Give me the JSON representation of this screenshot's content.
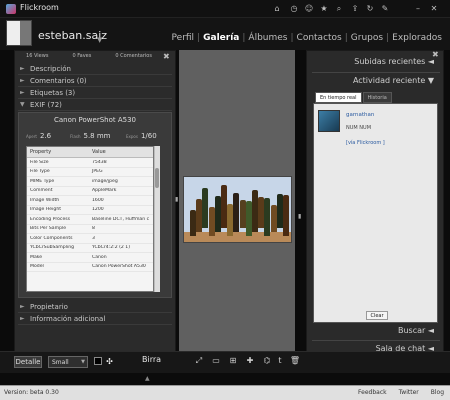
{
  "app": {
    "title": "Flickroom"
  },
  "titlebar_icons": [
    "home-icon",
    "clock-icon",
    "user-icon",
    "star-icon",
    "search-icon",
    "upload-icon",
    "refresh-icon",
    "tools-icon",
    "minimize-icon",
    "close-icon"
  ],
  "header": {
    "username": "esteban.saiz",
    "nav": [
      "Perfil",
      "Galería",
      "Álbumes",
      "Contactos",
      "Grupos",
      "Explorados"
    ],
    "active_nav": "Galería"
  },
  "left": {
    "counts": {
      "views": "16 Views",
      "faves": "0 Faves",
      "comments": "0 Comentarios"
    },
    "sections": [
      "Descripción",
      "Comentarios (0)",
      "Etiquetas (3)",
      "EXIF (72)"
    ],
    "bottom_sections": [
      "Propietario",
      "Información adicional"
    ],
    "camera": "Canon PowerShot A530",
    "specs": [
      {
        "label": "Apert",
        "value": "2.6"
      },
      {
        "label": "Flash",
        "value": "5.8 mm"
      },
      {
        "label": "Expos",
        "value": "1/60"
      }
    ],
    "exif_headers": [
      "Property",
      "Value"
    ],
    "exif_rows": [
      [
        "File Size",
        "75438"
      ],
      [
        "File Type",
        "JPEG"
      ],
      [
        "MIME Type",
        "image/jpeg"
      ],
      [
        "Comment",
        "AppleMark"
      ],
      [
        "Image Width",
        "1600"
      ],
      [
        "Image Height",
        "1200"
      ],
      [
        "Encoding Process",
        "Baseline DCT, Huffman c"
      ],
      [
        "Bits Per Sample",
        "8"
      ],
      [
        "Color Components",
        "3"
      ],
      [
        "YCbCrSubSampling",
        "YCbCr4:2:2 (2 1)"
      ],
      [
        "Make",
        "Canon"
      ],
      [
        "Model",
        "Canon PowerShot A530"
      ]
    ]
  },
  "right": {
    "sections": [
      "Subidas recientes",
      "Actividad reciente",
      "Buscar",
      "Sala de chat"
    ],
    "tabs": [
      "En tiempo real",
      "Historia"
    ],
    "activity": {
      "user": "garnathan",
      "title": "NUM NUM",
      "via": "[vía Flickroom ]"
    },
    "clear": "Clear"
  },
  "toolbar": {
    "detail": "Detalle",
    "size": "Small",
    "photo_title": "Birra",
    "tools": [
      "expand-icon",
      "slideshow-icon",
      "add-to-set-icon",
      "add-note-icon",
      "tag-icon",
      "tumblr-icon",
      "trash-icon"
    ]
  },
  "status": {
    "version": "Version: beta 0.30",
    "links": [
      "Feedback",
      "Twitter",
      "Blog"
    ]
  }
}
